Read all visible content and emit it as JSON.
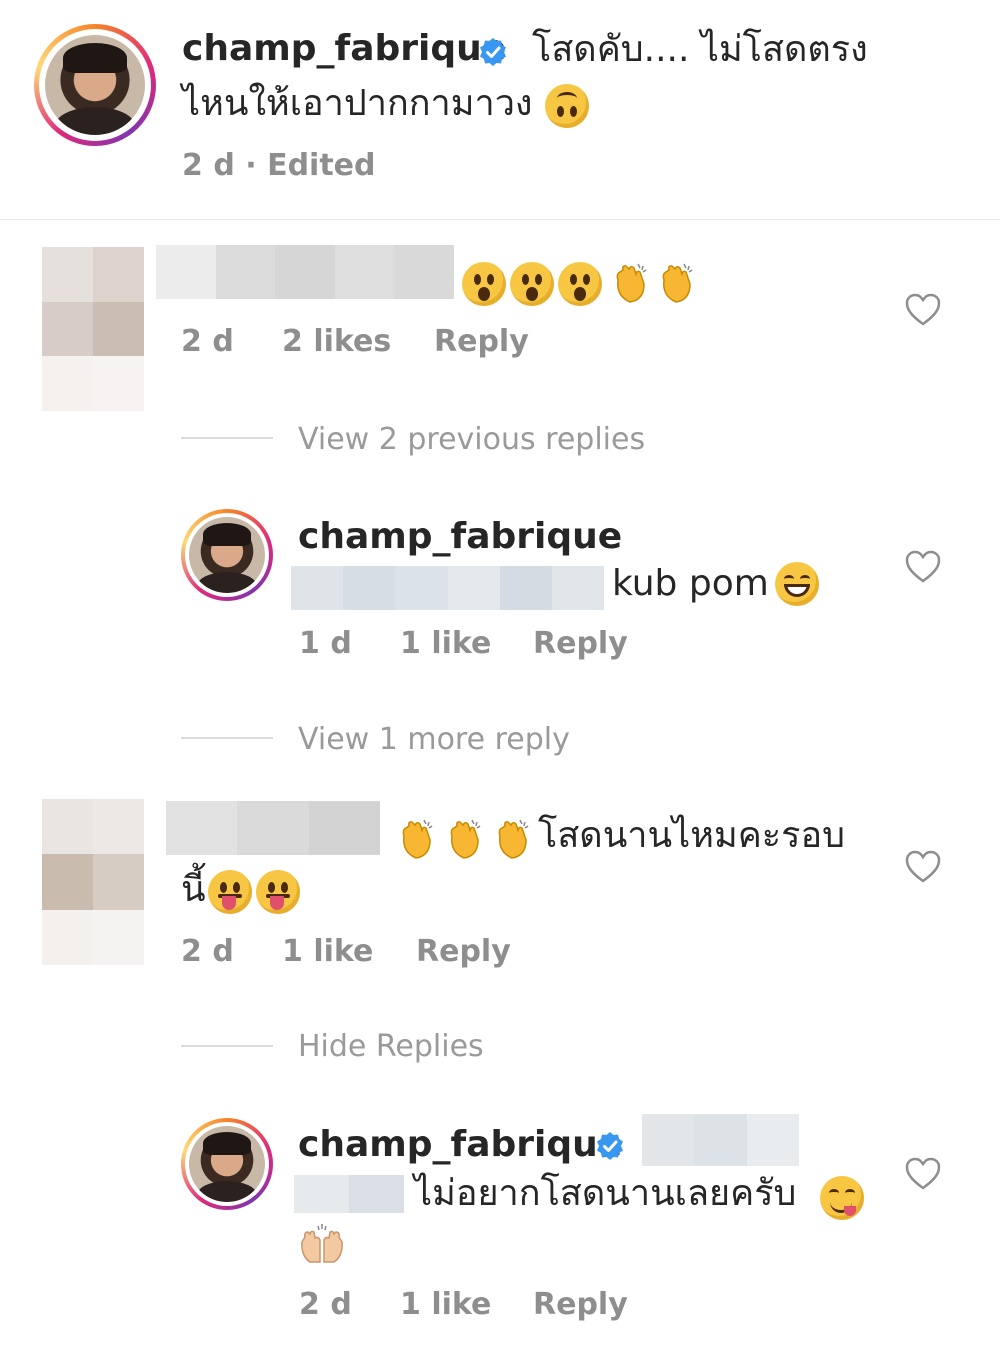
{
  "post": {
    "username": "champ_fabrique",
    "caption_line1": "โสดคับ.... ไม่โสดตรง",
    "caption_line2": "ไหนให้เอาปากกามาวง",
    "time": "2 d · Edited"
  },
  "comments": [
    {
      "time": "2 d",
      "likes": "2 likes",
      "reply_label": "Reply",
      "view_replies": "View 2 previous replies"
    },
    {
      "username": "champ_fabrique",
      "text": "kub pom",
      "time": "1 d",
      "likes": "1 like",
      "reply_label": "Reply",
      "view_replies": "View 1 more reply"
    },
    {
      "text_line1": "โสดนานไหมคะรอบ",
      "text_line2": "นี้",
      "time": "2 d",
      "likes": "1 like",
      "reply_label": "Reply",
      "view_replies": "Hide Replies"
    },
    {
      "username": "champ_fabrique",
      "text": "ไม่อยากโสดนานเลยครับ",
      "time": "2 d",
      "likes": "1 like",
      "reply_label": "Reply"
    }
  ],
  "colors": {
    "verified": "#3897f0",
    "meta_text": "#8e8e8e",
    "primary_text": "#262626",
    "divider": "#dbdbdb"
  },
  "icons": [
    "verified-badge-icon",
    "heart-icon",
    "upside-down-face-emoji",
    "hushed-face-emoji",
    "clapping-hands-emoji",
    "grinning-face-emoji",
    "tongue-face-emoji",
    "yum-face-emoji",
    "raising-hands-emoji"
  ]
}
